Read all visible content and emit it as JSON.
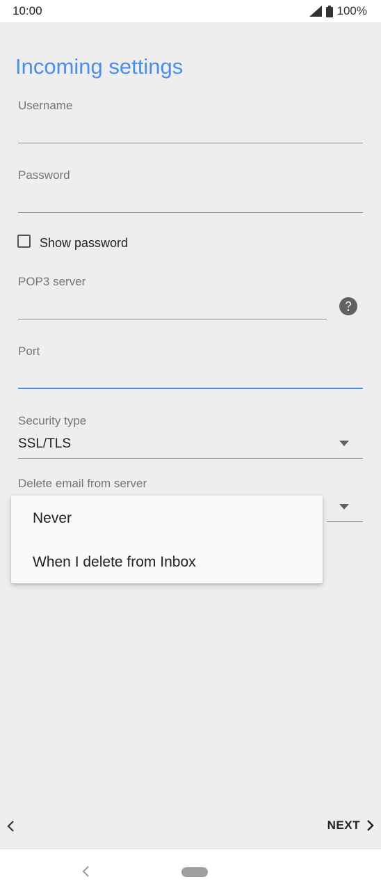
{
  "status_bar": {
    "time": "10:00",
    "battery": "100%"
  },
  "screen": {
    "title": "Incoming settings"
  },
  "fields": {
    "username": {
      "label": "Username",
      "value": ""
    },
    "password": {
      "label": "Password",
      "value": ""
    },
    "show_password": {
      "label": "Show password",
      "checked": false
    },
    "pop3_server": {
      "label": "POP3 server",
      "value": ""
    },
    "port": {
      "label": "Port",
      "value": ""
    },
    "security_type": {
      "label": "Security type",
      "value": "SSL/TLS"
    },
    "delete_email": {
      "label": "Delete email from server"
    }
  },
  "menu": {
    "items": [
      "Never",
      "When I delete from Inbox"
    ]
  },
  "footer": {
    "next_label": "NEXT"
  },
  "colors": {
    "accent": "#4a8fe7",
    "background": "#eeeeee",
    "text": "#212121",
    "label": "#757575"
  },
  "icons": {
    "signal": "signal-icon",
    "battery": "battery-icon",
    "help": "help-icon",
    "dropdown": "triangle-down-icon",
    "back": "chevron-left-icon",
    "next": "chevron-right-icon",
    "home": "home-pill-icon"
  }
}
